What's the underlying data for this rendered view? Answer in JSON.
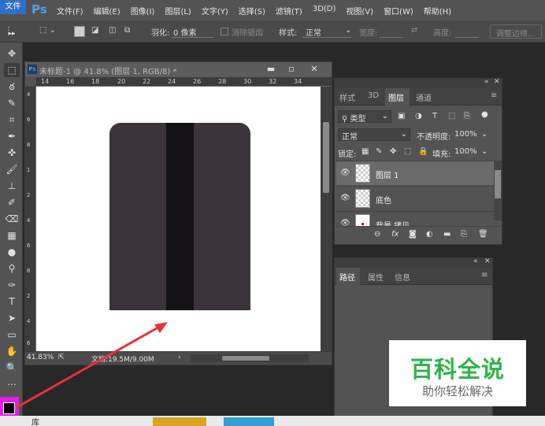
{
  "colors": {
    "accent": "#2f6fc8",
    "ps_blue": "#4aa3f0",
    "card": "#3b353b",
    "stripe": "#141214",
    "arrow": "#e8313a",
    "swatch": "#e21de8",
    "watermark_green": "#2fb44a"
  },
  "menubar": {
    "file_tab": "文件",
    "logo": "Ps",
    "items": [
      "文件(F)",
      "编辑(E)",
      "图像(I)",
      "图层(L)",
      "文字(Y)",
      "选择(S)",
      "滤镜(T)",
      "3D(D)",
      "视图(V)",
      "窗口(W)",
      "帮助(H)"
    ]
  },
  "options": {
    "feather_label": "羽化:",
    "feather_value": "0 像素",
    "antialias_label": "消除锯齿",
    "style_label": "样式:",
    "style_value": "正常",
    "width_label": "宽度:",
    "height_label": "高度:",
    "refine_button": "调整边缘..."
  },
  "document": {
    "title": "未标题-1 @ 41.8% (图层 1, RGB/8) *",
    "ps_mini": "Ps",
    "ruler_top": [
      "14",
      "16",
      "18",
      "20",
      "22",
      "24",
      "26",
      "28",
      "30",
      "32",
      "34"
    ],
    "ruler_left": [
      "4",
      "6",
      "8",
      "1",
      "2",
      "4",
      "6",
      "8",
      "2",
      "4",
      "6"
    ],
    "zoom": "41.83%",
    "doc_info": "文档:19.5M/9.00M",
    "status_arrow": "›"
  },
  "layers_panel": {
    "tabs": [
      "样式",
      "3D",
      "图层",
      "通道"
    ],
    "kind_label": "类型",
    "blend_mode": "正常",
    "opacity_label": "不透明度:",
    "opacity_value": "100%",
    "lock_label": "锁定:",
    "fill_label": "填充:",
    "fill_value": "100%",
    "layers": [
      {
        "name": "图层 1",
        "selected": true
      },
      {
        "name": "底色",
        "selected": false
      },
      {
        "name": "背景 拷贝",
        "selected": false
      }
    ]
  },
  "paths_panel": {
    "tabs": [
      "路径",
      "属性",
      "信息"
    ]
  },
  "watermark": {
    "title": "百科全说",
    "subtitle": "助你轻松解决"
  },
  "bottom": {
    "library": "库"
  }
}
